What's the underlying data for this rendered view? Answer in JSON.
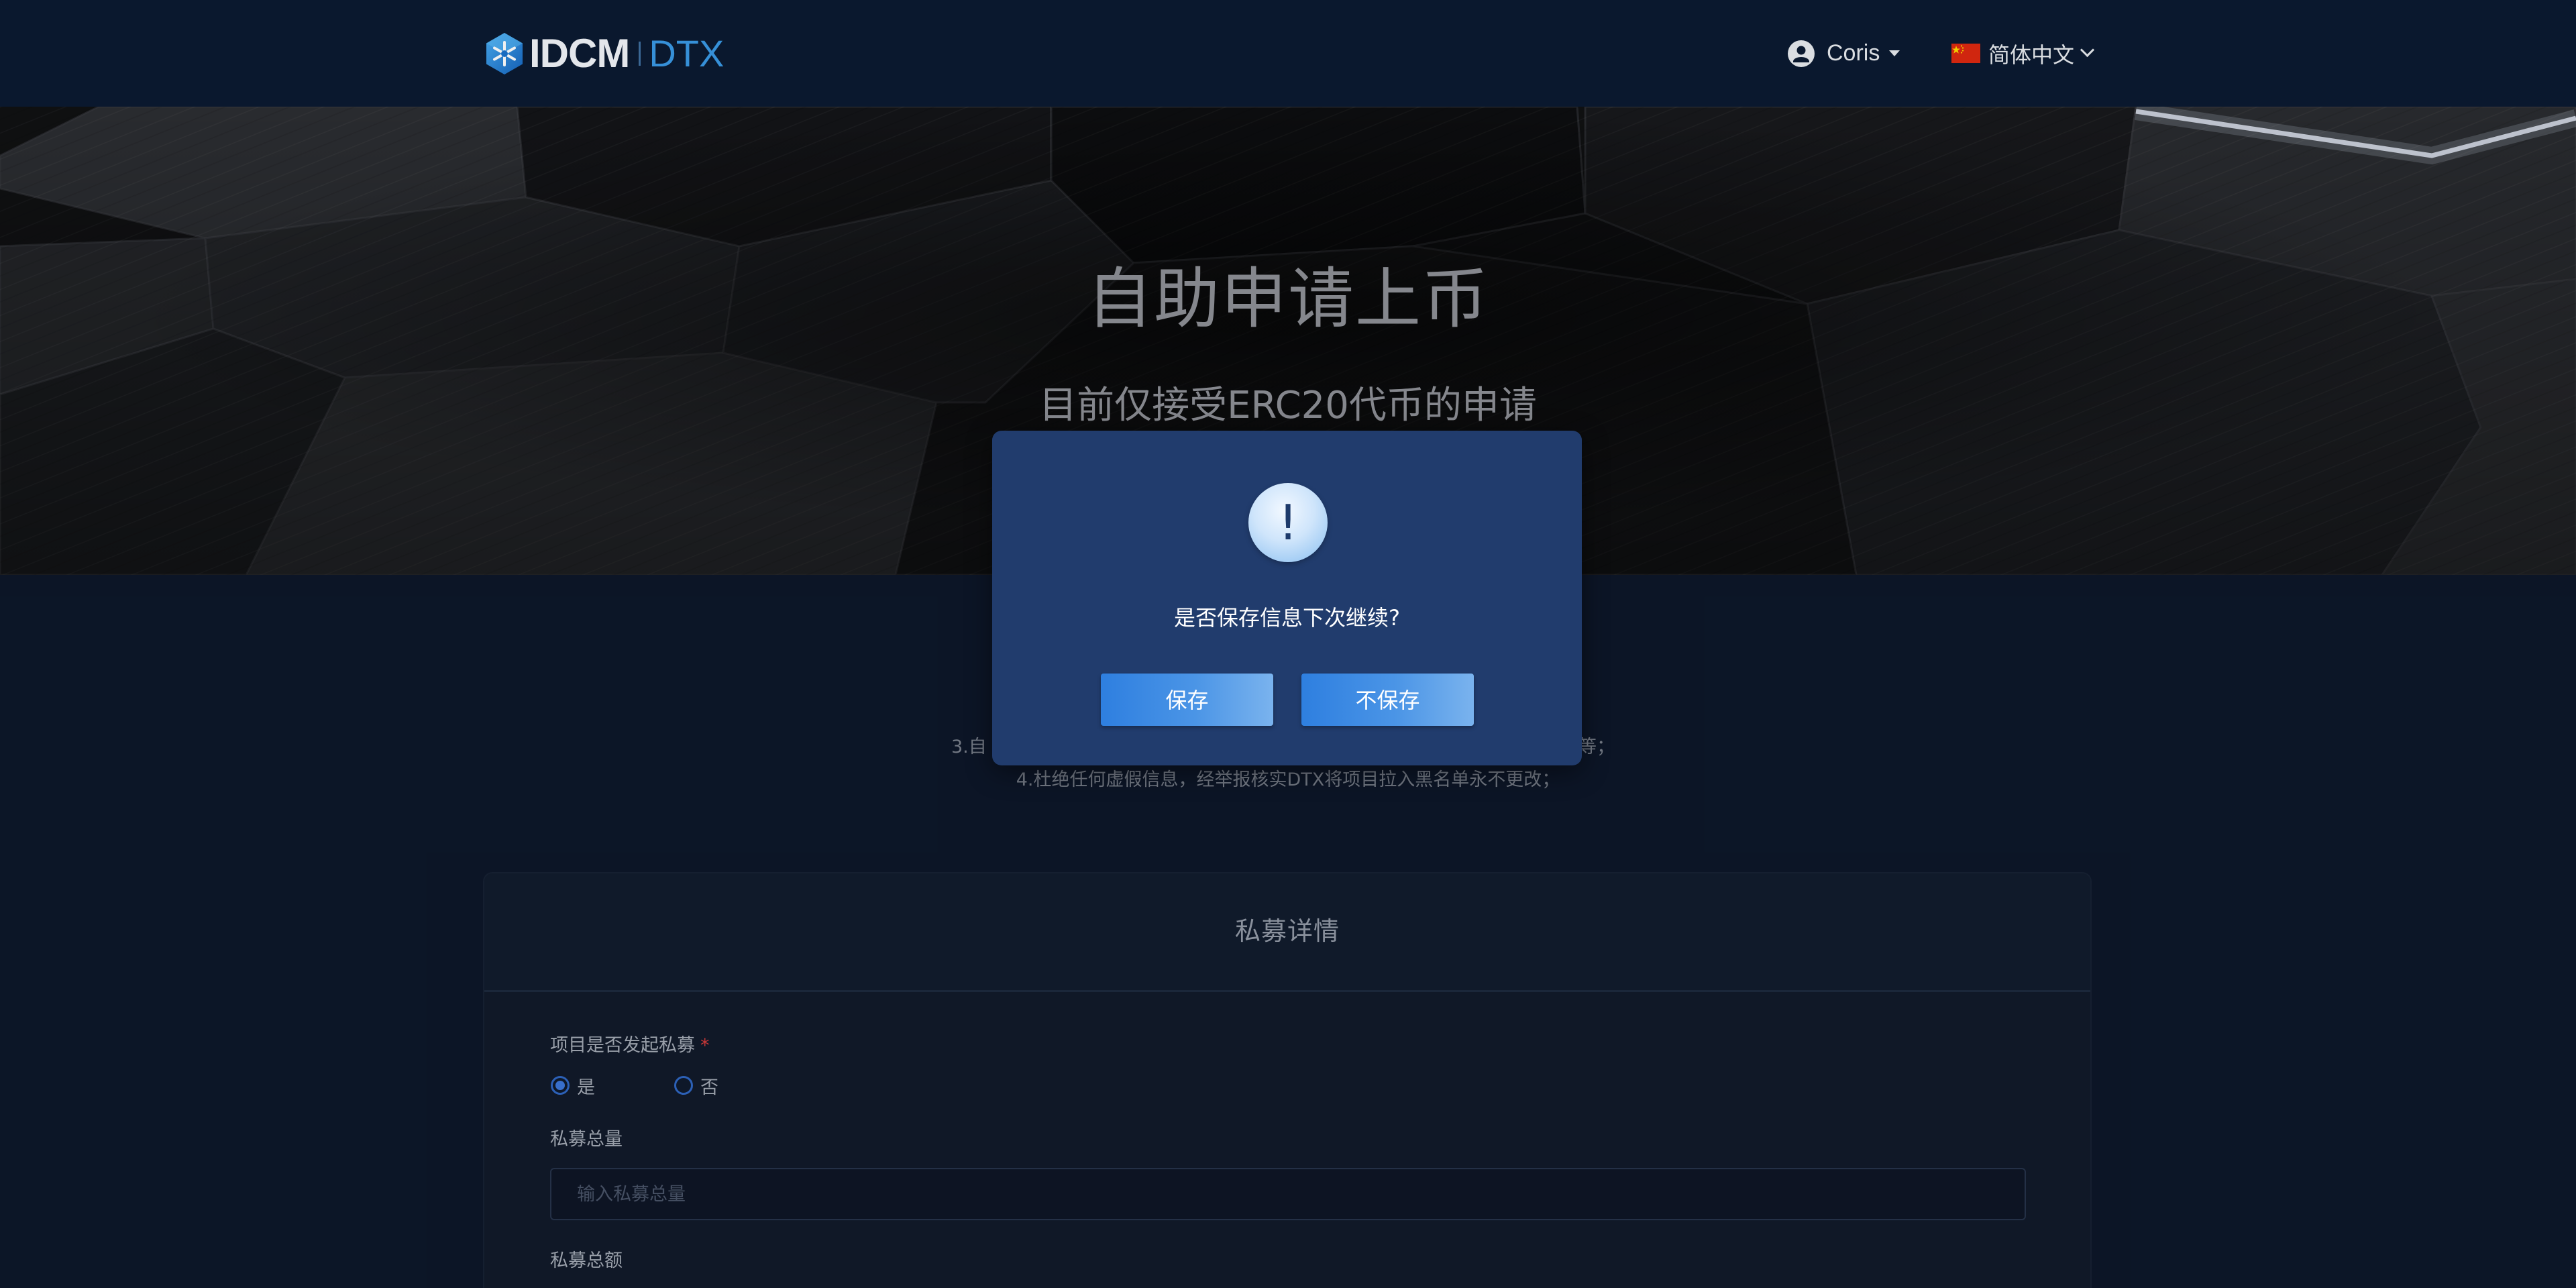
{
  "header": {
    "logo": {
      "brand": "IDCM",
      "product": "DTX",
      "icon": "idcm-hexagon-logo-icon"
    },
    "user": {
      "name": "Coris",
      "icon": "user-circle-icon",
      "caret": "caret-down-icon"
    },
    "language": {
      "label": "简体中文",
      "flag": "china-flag-icon",
      "chevron": "chevron-down-icon"
    }
  },
  "hero": {
    "title": "自助申请上币",
    "subtitle": "目前仅接受ERC20代币的申请"
  },
  "notes": {
    "line3_left": "3.自",
    "line3_right": "等；",
    "line4": "4.杜绝任何虚假信息，经举报核实DTX将项目拉入黑名单永不更改；"
  },
  "modal": {
    "icon": "exclamation-icon",
    "icon_text": "!",
    "message": "是否保存信息下次继续?",
    "confirm_label": "保存",
    "cancel_label": "不保存"
  },
  "form": {
    "section_title": "私募详情",
    "private_sale": {
      "label": "项目是否发起私募",
      "required_mark": "*",
      "options": [
        {
          "label": "是",
          "checked": true
        },
        {
          "label": "否",
          "checked": false
        }
      ]
    },
    "total_amount": {
      "label": "私募总量",
      "placeholder": "输入私募总量",
      "value": ""
    },
    "total_value": {
      "label": "私募总额"
    }
  },
  "colors": {
    "header_bg": "#0b1a31",
    "page_bg": "#0d1729",
    "modal_bg": "#213c6d",
    "accent": "#2e7fe0",
    "logo_accent": "#3a9ae6",
    "required": "#d23b3b"
  }
}
